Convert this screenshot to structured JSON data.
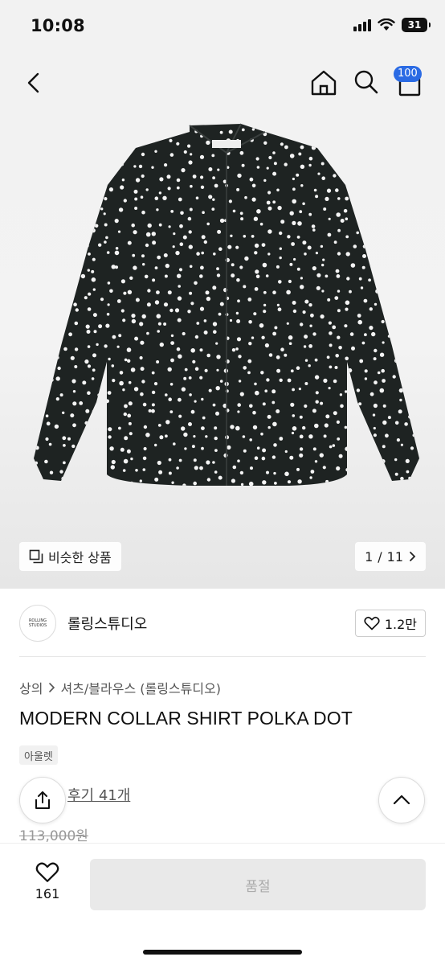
{
  "status_bar": {
    "time": "10:08",
    "battery": "31"
  },
  "nav": {
    "bag_count": "100"
  },
  "gallery": {
    "similar_label": "비슷한 상품",
    "page_current": "1",
    "page_total": "11",
    "page_separator": "/"
  },
  "brand": {
    "logo_text": "ROLLING STUDIOS",
    "name": "롤링스튜디오",
    "likes": "1.2만"
  },
  "breadcrumb": {
    "category": "상의",
    "subcategory": "셔츠/블라우스 (롤링스튜디오)"
  },
  "product": {
    "title": "MODERN COLLAR SHIRT POLKA DOT",
    "tag": "아울렛",
    "review_link": "후기 41개",
    "original_price": "113,000원"
  },
  "bottom_bar": {
    "wish_count": "161",
    "buy_label": "품절"
  },
  "colors": {
    "accent": "#2b6be4",
    "shirt": "#1e2322",
    "dot": "#f4f4f4"
  }
}
